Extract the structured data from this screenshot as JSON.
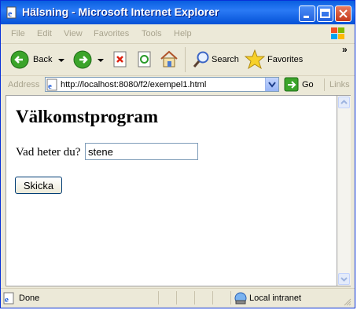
{
  "window": {
    "title": "Hälsning - Microsoft Internet Explorer"
  },
  "menu": {
    "items": [
      "File",
      "Edit",
      "View",
      "Favorites",
      "Tools",
      "Help"
    ]
  },
  "toolbar": {
    "back_label": "Back",
    "search_label": "Search",
    "favorites_label": "Favorites"
  },
  "address": {
    "label": "Address",
    "url": "http://localhost:8080/f2/exempel1.html",
    "go_label": "Go",
    "links_label": "Links"
  },
  "page": {
    "heading": "Välkomstprogram",
    "question": "Vad heter du?",
    "name_value": "stene",
    "submit_label": "Skicka"
  },
  "status": {
    "left": "Done",
    "zone": "Local intranet"
  }
}
